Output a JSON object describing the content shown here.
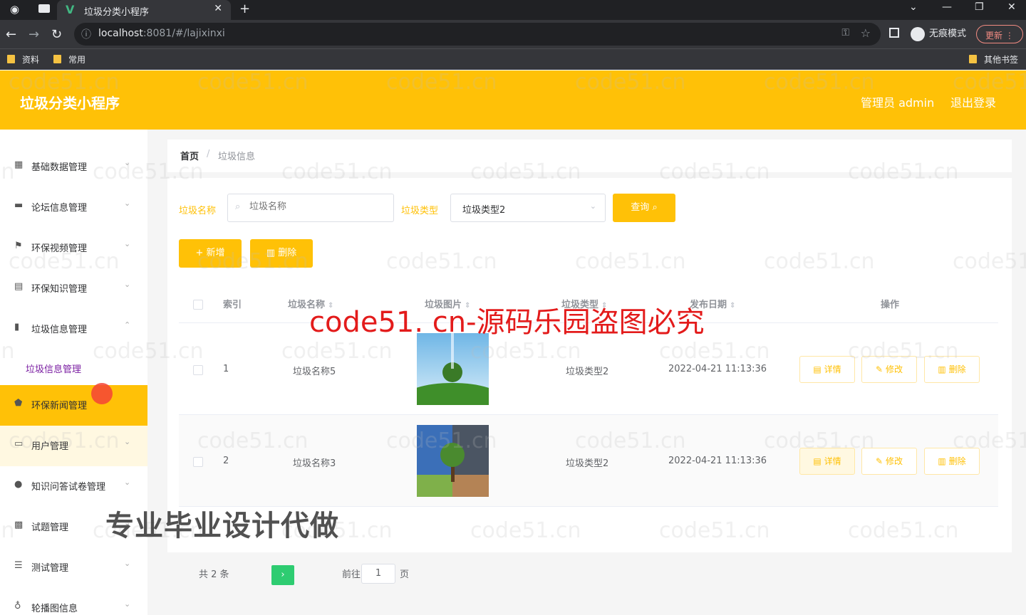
{
  "browser": {
    "tab_title": "垃圾分类小程序",
    "url_host": "localhost",
    "url_path": ":8081/#/lajixinxi",
    "incognito_label": "无痕模式",
    "update_label": "更新",
    "bookmarks": [
      "资料",
      "常用"
    ],
    "other_bookmarks": "其他书签"
  },
  "header": {
    "title": "垃圾分类小程序",
    "admin_label": "管理员 admin",
    "logout_label": "退出登录"
  },
  "sidebar": {
    "items": [
      {
        "label": "基础数据管理",
        "icon": "grid-icon"
      },
      {
        "label": "论坛信息管理",
        "icon": "monitor-icon"
      },
      {
        "label": "环保视频管理",
        "icon": "flag-icon"
      },
      {
        "label": "环保知识管理",
        "icon": "document-icon"
      },
      {
        "label": "垃圾信息管理",
        "icon": "bar-chart-icon"
      },
      {
        "label": "环保新闻管理",
        "icon": "shield-icon"
      },
      {
        "label": "用户管理",
        "icon": "message-icon"
      },
      {
        "label": "知识问答试卷管理",
        "icon": "user-icon"
      },
      {
        "label": "试题管理",
        "icon": "postcard-icon"
      },
      {
        "label": "测试管理",
        "icon": "list-icon"
      },
      {
        "label": "轮播图信息",
        "icon": "microphone-icon"
      }
    ],
    "submenu_label": "垃圾信息管理"
  },
  "breadcrumb": {
    "home": "首页",
    "separator": "/",
    "current": "垃圾信息"
  },
  "filters": {
    "name_label": "垃圾名称",
    "name_placeholder": "垃圾名称",
    "type_label": "垃圾类型",
    "type_value": "垃圾类型2",
    "query_label": "查询"
  },
  "actions": {
    "add_label": "+ 新增",
    "delete_label": "删除"
  },
  "table": {
    "headers": [
      "索引",
      "垃圾名称",
      "垃圾图片",
      "垃圾类型",
      "发布日期",
      "操作"
    ],
    "rows": [
      {
        "index": "1",
        "name": "垃圾名称5",
        "type": "垃圾类型2",
        "date": "2022-04-21 11:13:36"
      },
      {
        "index": "2",
        "name": "垃圾名称3",
        "type": "垃圾类型2",
        "date": "2022-04-21 11:13:36"
      }
    ],
    "op_detail": "详情",
    "op_edit": "修改",
    "op_delete": "删除"
  },
  "pagination": {
    "total_text": "共 2 条",
    "goto_label": "前往",
    "page_value": "1",
    "page_unit": "页"
  },
  "overlay": {
    "watermark_text": "code51. cn-源码乐园盗图必究",
    "promo_text": "专业毕业设计代做",
    "ghost_text": "code51.cn"
  },
  "colors": {
    "accent": "#ffc107",
    "watermark": "#e31b1b",
    "submenu": "#7b1fa2"
  }
}
